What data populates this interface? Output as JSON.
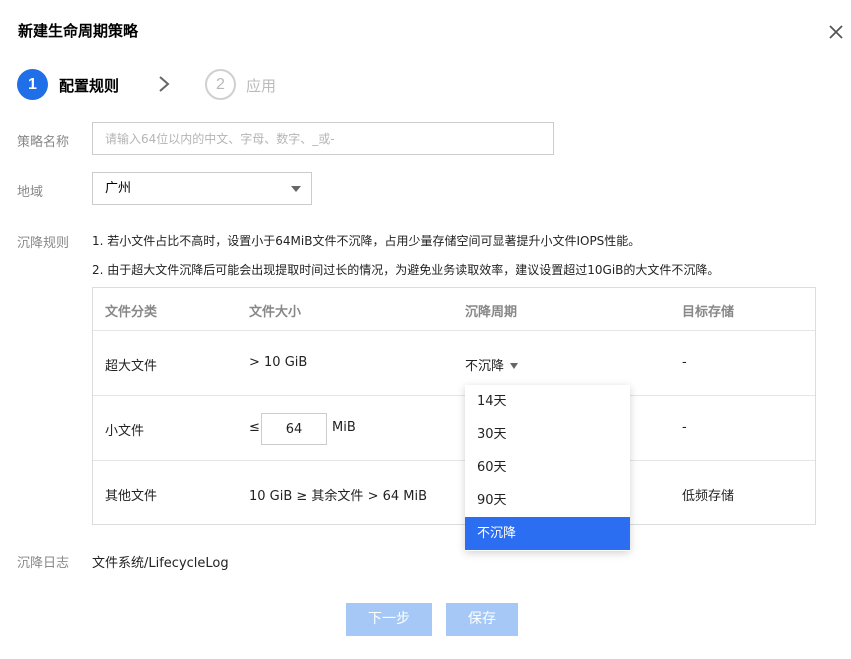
{
  "dialog": {
    "title": "新建生命周期策略"
  },
  "steps": [
    {
      "number": "1",
      "label": "配置规则",
      "state": "active"
    },
    {
      "number": "2",
      "label": "应用",
      "state": "inactive"
    }
  ],
  "form": {
    "name_label": "策略名称",
    "name_placeholder": "请输入64位以内的中文、字母、数字、_或-",
    "name_value": "",
    "region_label": "地域",
    "region_value": "广州",
    "rules_label": "沉降规则",
    "rules_notes": [
      "1. 若小文件占比不高时，设置小于64MiB文件不沉降，占用少量存储空间可显著提升小文件IOPS性能。",
      "2. 由于超大文件沉降后可能会出现提取时间过长的情况，为避免业务读取效率，建议设置超过10GiB的大文件不沉降。"
    ],
    "log_label": "沉降日志",
    "log_value": "文件系统/LifecycleLog"
  },
  "table": {
    "headers": [
      "文件分类",
      "文件大小",
      "沉降周期",
      "目标存储"
    ],
    "rows": [
      {
        "category": "超大文件",
        "size": "> 10 GiB",
        "period": "不沉降",
        "target": "-"
      },
      {
        "category": "小文件",
        "size_prefix": "≤",
        "size_value": "64",
        "size_unit": "MiB",
        "period": "",
        "target": "-"
      },
      {
        "category": "其他文件",
        "size": "10 GiB ≥ 其余文件 > 64 MiB",
        "period": "",
        "target": "低频存储"
      }
    ]
  },
  "dropdown": {
    "options": [
      "14天",
      "30天",
      "60天",
      "90天",
      "不沉降"
    ],
    "selected": "不沉降"
  },
  "buttons": {
    "next": "下一步",
    "save": "保存"
  },
  "colors": {
    "primary": "#1e6fe8",
    "selected_option": "#2c6ef2",
    "disabled_button": "#a6c8f6"
  }
}
